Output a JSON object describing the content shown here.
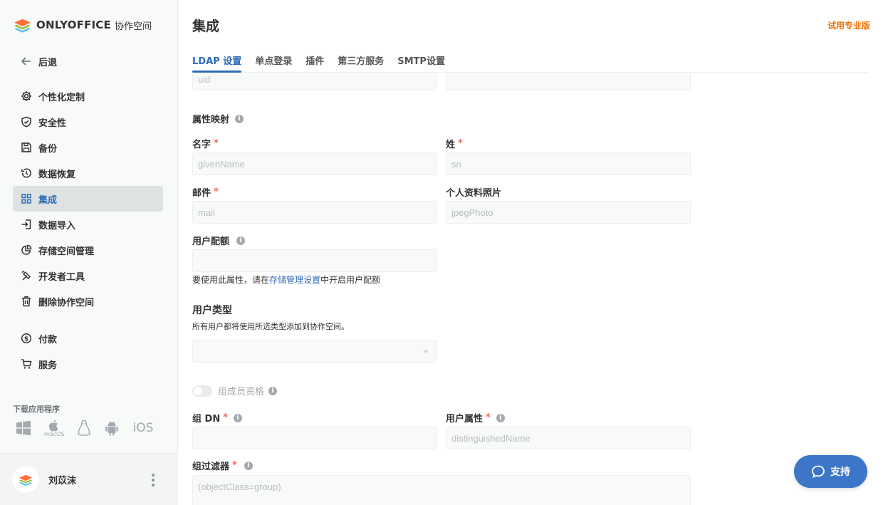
{
  "app": {
    "logo_text": "ONLYOFFICE",
    "logo_sub": "协作空间"
  },
  "sidebar": {
    "back_label": "后退",
    "items": [
      {
        "label": "个性化定制",
        "icon": "gear-icon"
      },
      {
        "label": "安全性",
        "icon": "shield-icon"
      },
      {
        "label": "备份",
        "icon": "save-icon"
      },
      {
        "label": "数据恢复",
        "icon": "history-icon"
      },
      {
        "label": "集成",
        "icon": "grid-icon",
        "active": true
      },
      {
        "label": "数据导入",
        "icon": "import-icon"
      },
      {
        "label": "存储空间管理",
        "icon": "pie-chart-icon"
      },
      {
        "label": "开发者工具",
        "icon": "tools-icon"
      },
      {
        "label": "删除协作空间",
        "icon": "trash-icon"
      }
    ],
    "payment_label": "付款",
    "services_label": "服务",
    "download_label": "下载应用程序",
    "macos_caption": "macOS",
    "ios_label": "iOS"
  },
  "profile": {
    "name": "刘苡沫"
  },
  "header": {
    "title": "集成",
    "trial_label": "试用专业版"
  },
  "tabs": [
    {
      "label": "LDAP 设置",
      "active": true
    },
    {
      "label": "单点登录"
    },
    {
      "label": "插件"
    },
    {
      "label": "第三方服务"
    },
    {
      "label": "SMTP设置"
    }
  ],
  "form": {
    "top_left_value": "uid",
    "attribute_mapping_title": "属性映射",
    "first_name_label": "名字",
    "first_name_value": "givenName",
    "last_name_label": "姓",
    "last_name_value": "sn",
    "mail_label": "邮件",
    "mail_value": "mail",
    "photo_label": "个人资料照片",
    "photo_value": "jpegPhoto",
    "quota_label": "用户配额",
    "quota_hint_prefix": "要使用此属性，请在",
    "quota_hint_link": "存储管理设置",
    "quota_hint_suffix": "中开启用户配额",
    "user_type_title": "用户类型",
    "user_type_desc": "所有用户都将使用所选类型添加到协作空间。",
    "group_membership_label": "组成员资格",
    "group_dn_label": "组 DN",
    "user_attr_label": "用户属性",
    "user_attr_value": "distinguishedName",
    "group_filter_label": "组过滤器",
    "group_filter_value": "(objectClass=group)",
    "required_mark": "*",
    "info_glyph": "i"
  },
  "support": {
    "label": "支持"
  }
}
